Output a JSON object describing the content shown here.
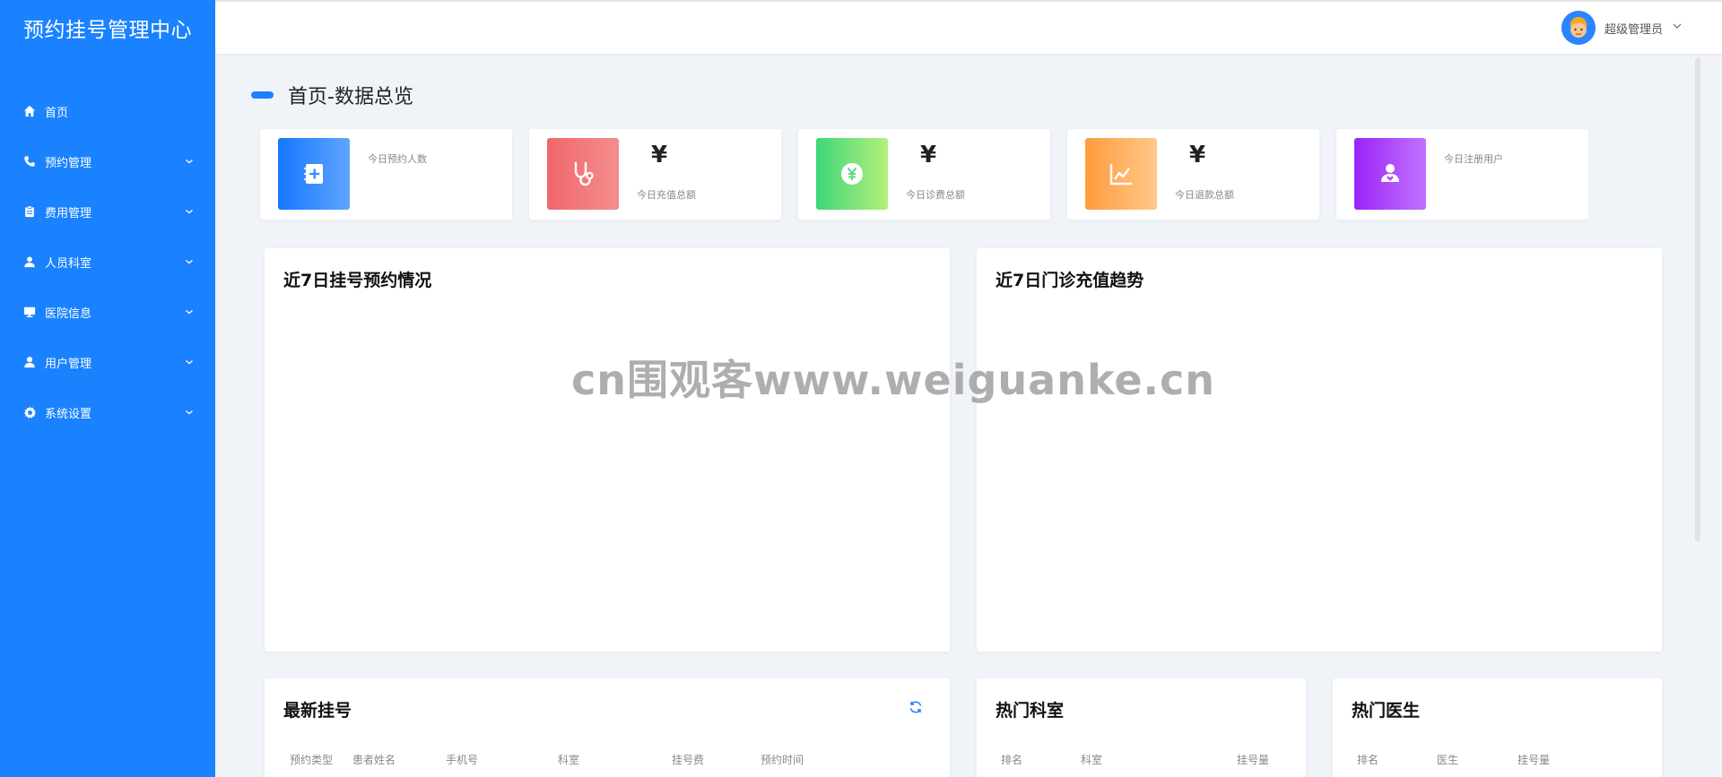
{
  "sidebar": {
    "brand": "预约挂号管理中心",
    "items": [
      {
        "label": "首页",
        "icon": "home-icon",
        "expandable": false
      },
      {
        "label": "预约管理",
        "icon": "phone-icon",
        "expandable": true
      },
      {
        "label": "费用管理",
        "icon": "clipboard-icon",
        "expandable": true
      },
      {
        "label": "人员科室",
        "icon": "person-icon",
        "expandable": true
      },
      {
        "label": "医院信息",
        "icon": "monitor-icon",
        "expandable": true
      },
      {
        "label": "用户管理",
        "icon": "user-icon",
        "expandable": true
      },
      {
        "label": "系统设置",
        "icon": "gear-icon",
        "expandable": true
      }
    ]
  },
  "header": {
    "user_name": "超级管理员"
  },
  "page": {
    "title": "首页-数据总览"
  },
  "stats": [
    {
      "label": "今日预约人数",
      "value": "",
      "color_from": "#1677ff",
      "color_to": "#5fa5ff",
      "icon": "appointment-book-icon"
    },
    {
      "label": "今日充值总额",
      "value": "¥",
      "color_from": "#f0676a",
      "color_to": "#f58d8f",
      "icon": "stethoscope-icon"
    },
    {
      "label": "今日诊费总额",
      "value": "¥",
      "color_from": "#3dd67a",
      "color_to": "#b7f07a",
      "icon": "yen-coin-icon"
    },
    {
      "label": "今日退款总额",
      "value": "¥",
      "color_from": "#ff9b3d",
      "color_to": "#ffc98a",
      "icon": "line-chart-icon"
    },
    {
      "label": "今日注册用户",
      "value": "",
      "color_from": "#9a23f5",
      "color_to": "#c173ff",
      "icon": "person-heart-icon"
    }
  ],
  "charts": {
    "appointments_title": "近7日挂号预约情况",
    "recharge_title": "近7日门诊充值趋势"
  },
  "latest": {
    "title": "最新挂号",
    "columns": [
      "预约类型",
      "患者姓名",
      "手机号",
      "科室",
      "挂号费",
      "预约时间"
    ]
  },
  "hot_departments": {
    "title": "热门科室",
    "columns": [
      "排名",
      "科室",
      "挂号量"
    ]
  },
  "hot_doctors": {
    "title": "热门医生",
    "columns": [
      "排名",
      "医生",
      "挂号量"
    ]
  },
  "watermark": "cn围观客www.weiguanke.cn",
  "colors": {
    "sidebar": "#1a82ff",
    "accent": "#1a82ff",
    "background": "#f0f4f9"
  }
}
